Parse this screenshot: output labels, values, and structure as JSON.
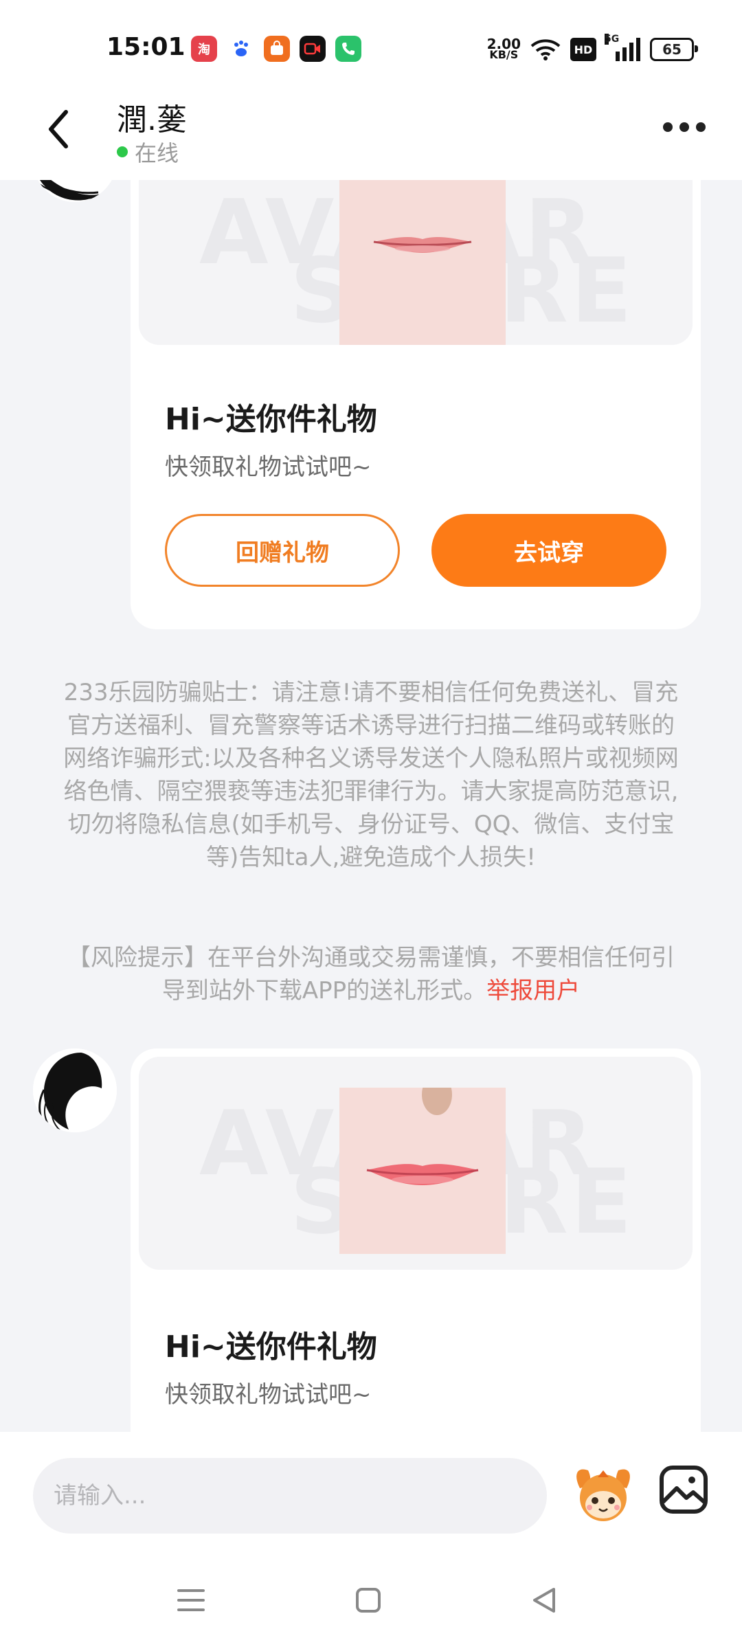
{
  "status_bar": {
    "time": "15:01",
    "net_speed_value": "2.00",
    "net_speed_unit": "KB/S",
    "hd_label": "HD",
    "signal_label": "5G",
    "battery": "65",
    "notification_icons": [
      "taobao-icon",
      "baidu-icon",
      "shopping-icon",
      "video-call-icon",
      "phone-icon"
    ]
  },
  "header": {
    "contact_name": "潤.蓌",
    "online_status": "在线"
  },
  "messages": [
    {
      "title": "Hi~送你件礼物",
      "subtitle": "快领取礼物试试吧~",
      "secondary_button": "回赠礼物",
      "primary_button": "去试穿"
    },
    {
      "title": "Hi~送你件礼物",
      "subtitle": "快领取礼物试试吧~"
    }
  ],
  "safety_tip": "233乐园防骗贴士：请注意!请不要相信任何免费送礼、冒充官方送福利、冒充警察等话术诱导进行扫描二维码或转账的网络诈骗形式:以及各种名义诱导发送个人隐私照片或视频网络色情、隔空猥亵等违法犯罪律行为。请大家提高防范意识,切勿将隐私信息(如手机号、身份证号、QQ、微信、支付宝等)告知ta人,避免造成个人损失!",
  "risk_notice": {
    "text": "【风险提示】在平台外沟通或交易需谨慎，不要相信任何引导到站外下载APP的送礼形式。",
    "report_link": "举报用户"
  },
  "input": {
    "placeholder": "请输入..."
  },
  "watermark": {
    "line1": "AVATAR",
    "line2": "STORE"
  },
  "colors": {
    "accent": "#fd7b16",
    "online": "#2cc84a",
    "report": "#ee4a3b"
  }
}
